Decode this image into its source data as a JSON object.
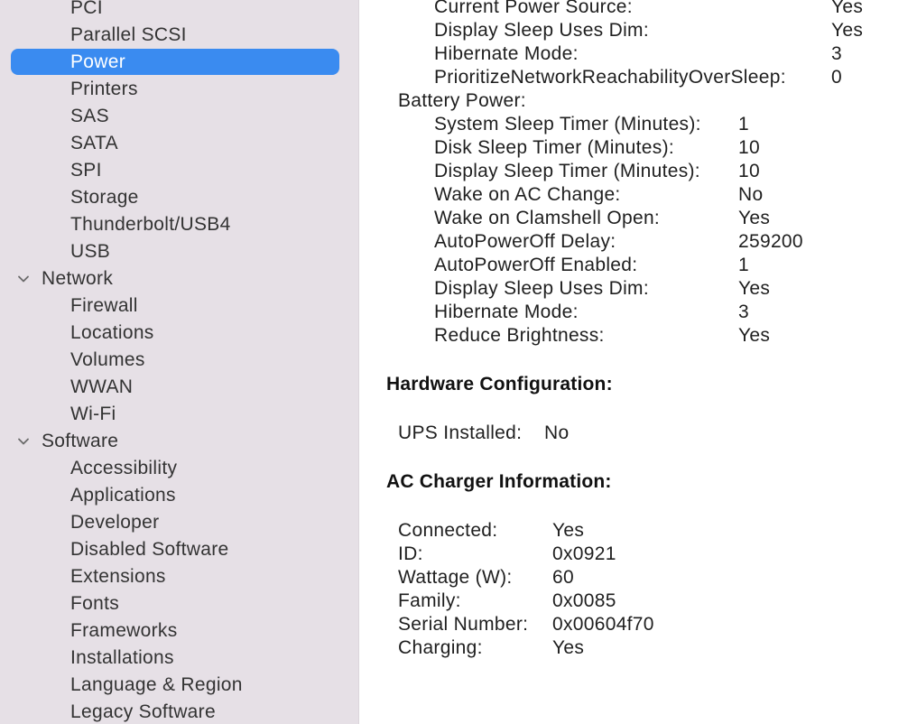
{
  "sidebar": {
    "items": [
      {
        "label": "PCI",
        "type": "child"
      },
      {
        "label": "Parallel SCSI",
        "type": "child"
      },
      {
        "label": "Power",
        "type": "child",
        "selected": true
      },
      {
        "label": "Printers",
        "type": "child"
      },
      {
        "label": "SAS",
        "type": "child"
      },
      {
        "label": "SATA",
        "type": "child"
      },
      {
        "label": "SPI",
        "type": "child"
      },
      {
        "label": "Storage",
        "type": "child"
      },
      {
        "label": "Thunderbolt/USB4",
        "type": "child"
      },
      {
        "label": "USB",
        "type": "child"
      },
      {
        "label": "Network",
        "type": "group",
        "icon": "chevron-down-icon"
      },
      {
        "label": "Firewall",
        "type": "child"
      },
      {
        "label": "Locations",
        "type": "child"
      },
      {
        "label": "Volumes",
        "type": "child"
      },
      {
        "label": "WWAN",
        "type": "child"
      },
      {
        "label": "Wi-Fi",
        "type": "child"
      },
      {
        "label": "Software",
        "type": "group",
        "icon": "chevron-down-icon"
      },
      {
        "label": "Accessibility",
        "type": "child"
      },
      {
        "label": "Applications",
        "type": "child"
      },
      {
        "label": "Developer",
        "type": "child"
      },
      {
        "label": "Disabled Software",
        "type": "child"
      },
      {
        "label": "Extensions",
        "type": "child"
      },
      {
        "label": "Fonts",
        "type": "child"
      },
      {
        "label": "Frameworks",
        "type": "child"
      },
      {
        "label": "Installations",
        "type": "child"
      },
      {
        "label": "Language & Region",
        "type": "child"
      },
      {
        "label": "Legacy Software",
        "type": "child"
      }
    ]
  },
  "ac_power": {
    "rows": [
      {
        "key": "Current Power Source:",
        "value": "Yes"
      },
      {
        "key": "Display Sleep Uses Dim:",
        "value": "Yes"
      },
      {
        "key": "Hibernate Mode:",
        "value": "3"
      },
      {
        "key": "PrioritizeNetworkReachabilityOverSleep:",
        "value": "0"
      }
    ]
  },
  "battery_power": {
    "title": "Battery Power:",
    "rows": [
      {
        "key": "System Sleep Timer (Minutes):",
        "value": "1"
      },
      {
        "key": "Disk Sleep Timer (Minutes):",
        "value": "10"
      },
      {
        "key": "Display Sleep Timer (Minutes):",
        "value": "10"
      },
      {
        "key": "Wake on AC Change:",
        "value": "No"
      },
      {
        "key": "Wake on Clamshell Open:",
        "value": "Yes"
      },
      {
        "key": "AutoPowerOff Delay:",
        "value": "259200"
      },
      {
        "key": "AutoPowerOff Enabled:",
        "value": "1"
      },
      {
        "key": "Display Sleep Uses Dim:",
        "value": "Yes"
      },
      {
        "key": "Hibernate Mode:",
        "value": "3"
      },
      {
        "key": "Reduce Brightness:",
        "value": "Yes"
      }
    ]
  },
  "hardware": {
    "title": "Hardware Configuration:",
    "ups_key": "UPS Installed:",
    "ups_value": "No"
  },
  "charger": {
    "title": "AC Charger Information:",
    "rows": [
      {
        "key": "Connected:",
        "value": "Yes"
      },
      {
        "key": "ID:",
        "value": "0x0921"
      },
      {
        "key": "Wattage (W):",
        "value": "60"
      },
      {
        "key": "Family:",
        "value": "0x0085"
      },
      {
        "key": "Serial Number:",
        "value": "0x00604f70"
      },
      {
        "key": "Charging:",
        "value": "Yes"
      }
    ]
  },
  "colors": {
    "sidebar_bg": "#e6e0e6",
    "selection": "#3a8bf0"
  }
}
